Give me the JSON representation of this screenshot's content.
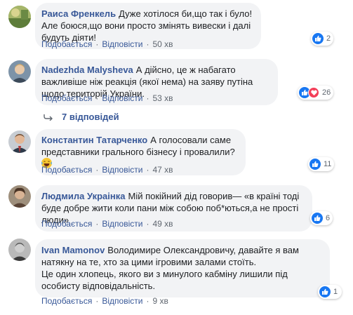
{
  "comments": [
    {
      "author": "Раиса Френкель",
      "text": "Дуже хотілося би,що так і було!Але боюся,що вони просто змінять вивески і далі будуть діяти!",
      "like_label": "Подобається",
      "reply_label": "Відповісти",
      "time": "50 хв",
      "reaction_count": "2",
      "avatar_icon": "nature-avatar-icon"
    },
    {
      "author": "Nadezhda Malysheva",
      "text": "А дійсно, це ж набагато важливіше ніж реакція (якої нема) на заяву путіна щодо територій України.",
      "like_label": "Подобається",
      "reply_label": "Відповісти",
      "time": "53 хв",
      "reaction_count": "26",
      "avatar_icon": "person-avatar-icon"
    },
    {
      "author": "Константин Татарченко",
      "text": "А голосовали саме представники грального бізнесу і провалили?",
      "like_label": "Подобається",
      "reply_label": "Відповісти",
      "time": "47 хв",
      "reaction_count": "11",
      "avatar_icon": "person-avatar-icon"
    },
    {
      "author": "Людмила Украінка",
      "text": "Мій покійний дід говорив— «в країні тоді буде добре жити коли пани між собою поб*ються,а не прості люди»",
      "like_label": "Подобається",
      "reply_label": "Відповісти",
      "time": "49 хв",
      "reaction_count": "6",
      "avatar_icon": "person-avatar-icon"
    },
    {
      "author": "Ivan Mamonov",
      "text": "Володимире Олександровичу, давайте я вам натякну на те, хто за цими ігровими залами стоїть.",
      "text2": "Це один хлопець, якого ви з минулого кабміну лишили під особисту відповідальність.",
      "like_label": "Подобається",
      "reply_label": "Відповісти",
      "time": "9 хв",
      "reaction_count": "1",
      "avatar_icon": "person-avatar-icon"
    }
  ],
  "replies_label": "7 відповідей",
  "colors": {
    "link": "#385898",
    "bubble": "#f2f3f5",
    "meta": "#606770",
    "like": "#1877f2",
    "heart": "#f33e58"
  }
}
